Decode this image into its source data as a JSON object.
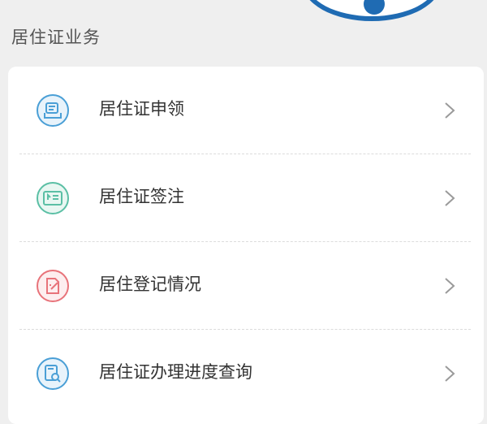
{
  "section": {
    "title": "居住证业务"
  },
  "items": [
    {
      "label": "居住证申领",
      "icon": "id-card-icon",
      "color": "#4a9fd6"
    },
    {
      "label": "居住证签注",
      "icon": "endorsement-icon",
      "color": "#5bbfa5"
    },
    {
      "label": "居住登记情况",
      "icon": "registration-edit-icon",
      "color": "#e8737a"
    },
    {
      "label": "居住证办理进度查询",
      "icon": "progress-search-icon",
      "color": "#4a9fd6"
    }
  ]
}
